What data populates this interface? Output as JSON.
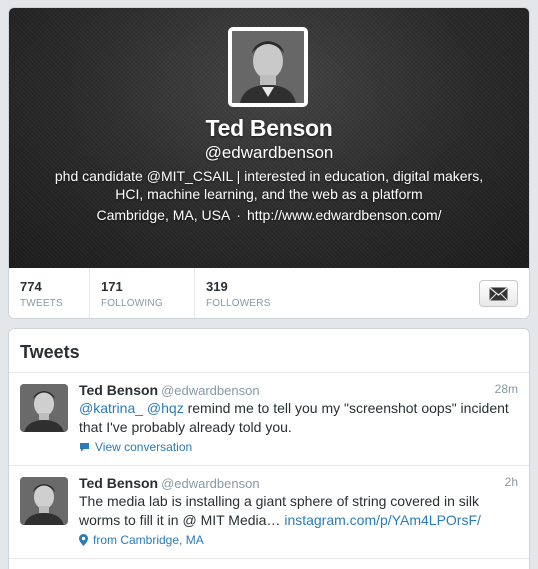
{
  "profile": {
    "name": "Ted Benson",
    "handle": "@edwardbenson",
    "bio": "phd candidate @MIT_CSAIL | interested in education, digital makers, HCI, machine learning, and the web as a platform",
    "location": "Cambridge, MA, USA",
    "separator": "·",
    "url": "http://www.edwardbenson.com/"
  },
  "stats": [
    {
      "count": "774",
      "label": "TWEETS"
    },
    {
      "count": "171",
      "label": "FOLLOWING"
    },
    {
      "count": "319",
      "label": "FOLLOWERS"
    }
  ],
  "message_button": {
    "icon": "envelope-icon"
  },
  "tweets_section": {
    "heading": "Tweets",
    "items": [
      {
        "fullname": "Ted Benson",
        "screen_name": "@edwardbenson",
        "time": "28m",
        "mention1": "@katrina_",
        "mention2": "@hqz",
        "text": " remind me to tell you my \"screenshot oops\" incident that I've probably already told you.",
        "meta_label": "View conversation",
        "meta_icon": "speech-bubble-icon"
      },
      {
        "fullname": "Ted Benson",
        "screen_name": "@edwardbenson",
        "time": "2h",
        "text": "The media lab is installing a giant sphere of string covered in silk worms to fill it in @ MIT Media… ",
        "link": "instagram.com/p/YAm4LPOrsF/",
        "meta_label": "from Cambridge, MA",
        "meta_icon": "location-pin-icon"
      }
    ]
  },
  "colors": {
    "link": "#2b7bb9",
    "muted": "#8899a6",
    "header_bg": "#2a2a2a"
  }
}
